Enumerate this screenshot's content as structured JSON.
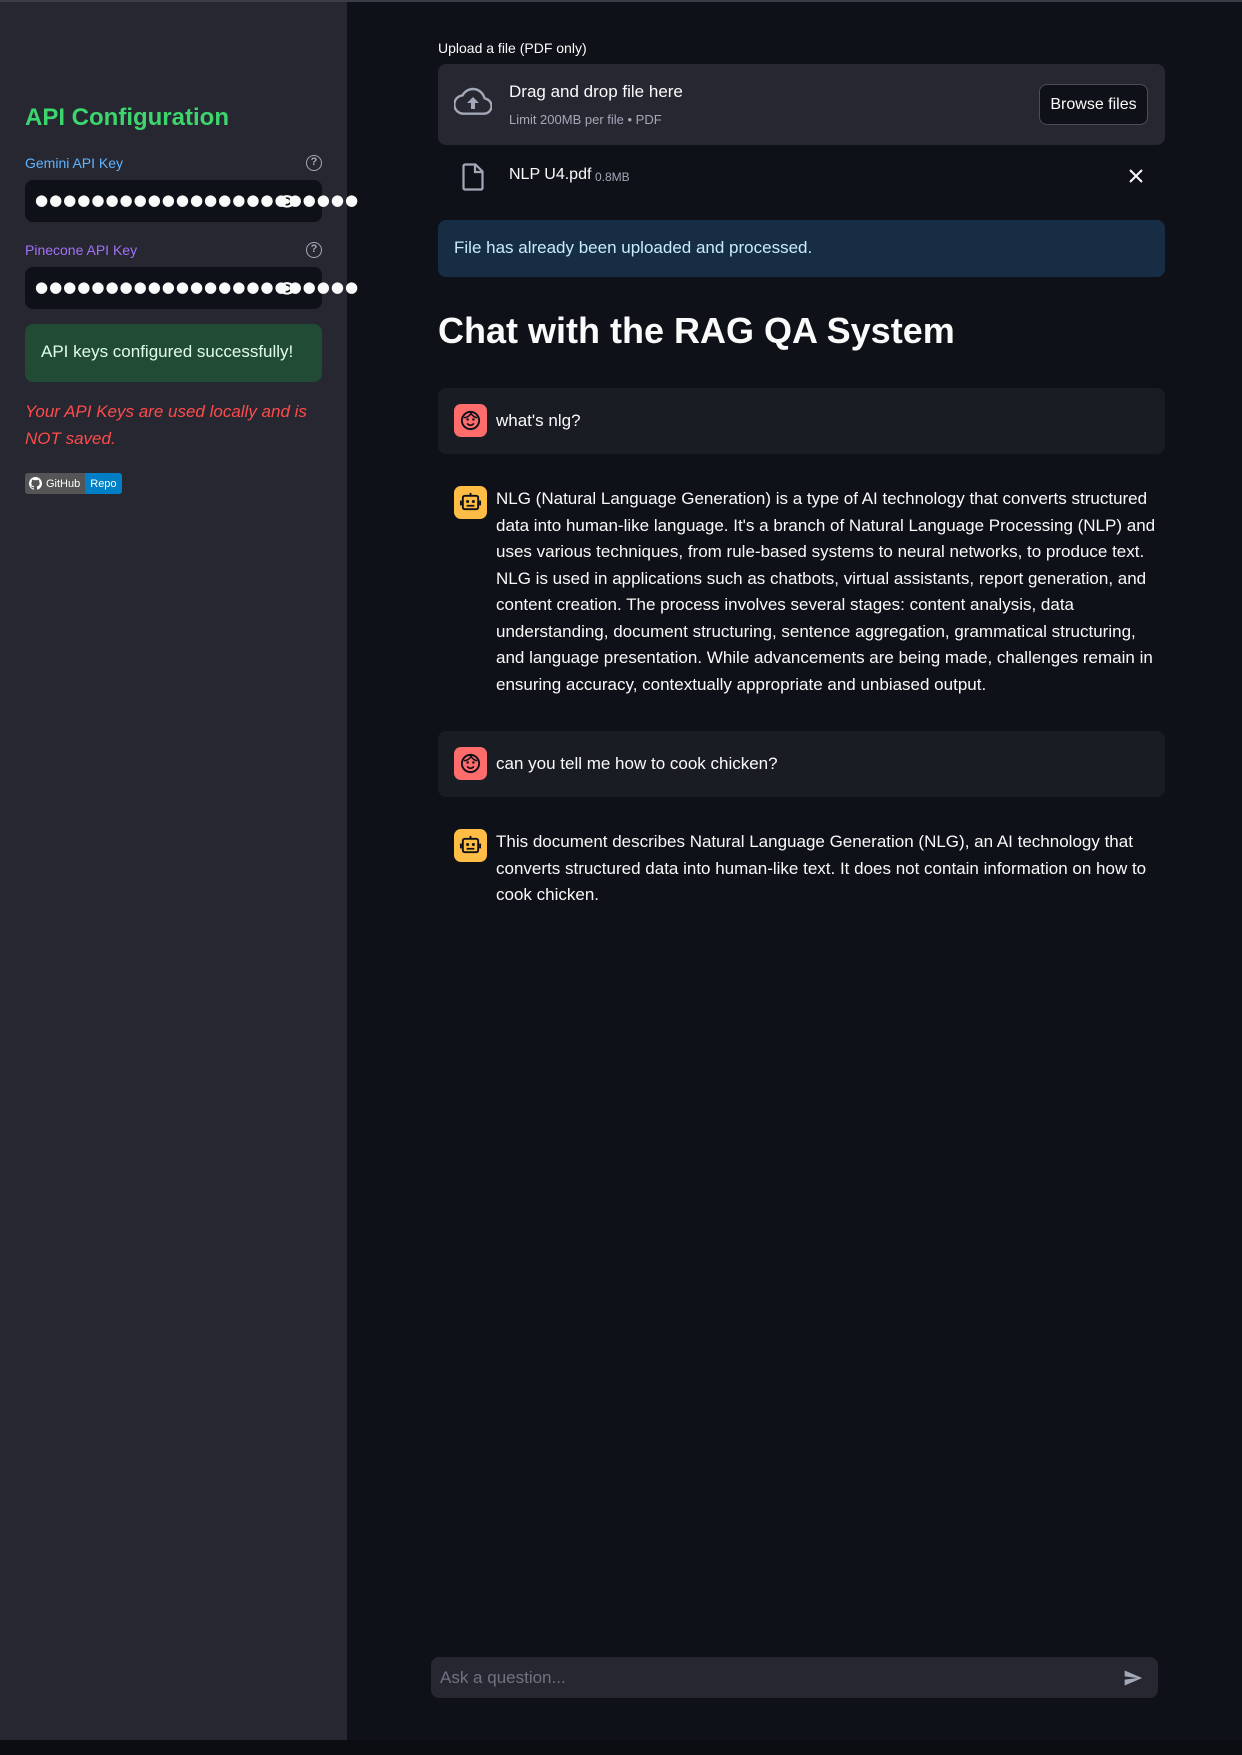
{
  "sidebar": {
    "title": "API Configuration",
    "gemini_label": "Gemini API Key",
    "pinecone_label": "Pinecone API Key",
    "gemini_masked": "●●●●●●●●●●●●●●●●●●●●●●●",
    "pinecone_masked": "●●●●●●●●●●●●●●●●●●●●●●●",
    "success_message": "API keys configured successfully!",
    "warning": "Your API Keys are used locally and is NOT saved.",
    "badge_left": "GitHub",
    "badge_right": "Repo"
  },
  "upload": {
    "label": "Upload a file (PDF only)",
    "drop_title": "Drag and drop file here",
    "drop_sub": "Limit 200MB per file • PDF",
    "browse_label": "Browse files",
    "file_name": "NLP U4.pdf",
    "file_size": "0.8MB",
    "info_message": "File has already been uploaded and processed."
  },
  "chat": {
    "title": "Chat with the RAG QA System",
    "messages": [
      {
        "role": "user",
        "text": "what's nlg?"
      },
      {
        "role": "assistant",
        "text": "NLG (Natural Language Generation) is a type of AI technology that converts structured data into human-like language. It's a branch of Natural Language Processing (NLP) and uses various techniques, from rule-based systems to neural networks, to produce text. NLG is used in applications such as chatbots, virtual assistants, report generation, and content creation. The process involves several stages: content analysis, data understanding, document structuring, sentence aggregation, grammatical structuring, and language presentation. While advancements are being made, challenges remain in ensuring accuracy, contextually appropriate and unbiased output."
      },
      {
        "role": "user",
        "text": "can you tell me how to cook chicken?"
      },
      {
        "role": "assistant",
        "text": "This document describes Natural Language Generation (NLG), an AI technology that converts structured data into human-like text. It does not contain information on how to cook chicken."
      }
    ],
    "input_placeholder": "Ask a question..."
  },
  "colors": {
    "background": "#0e1117",
    "sidebar": "#262730",
    "accent_green": "#3dd56d",
    "error_red": "#ff4b4b",
    "user_avatar": "#ff6c6c",
    "bot_avatar": "#ffbd45"
  },
  "icons": [
    "help-icon",
    "eye-icon",
    "github-icon",
    "cloud-upload-icon",
    "file-icon",
    "close-icon",
    "user-face-icon",
    "robot-icon",
    "send-icon"
  ]
}
